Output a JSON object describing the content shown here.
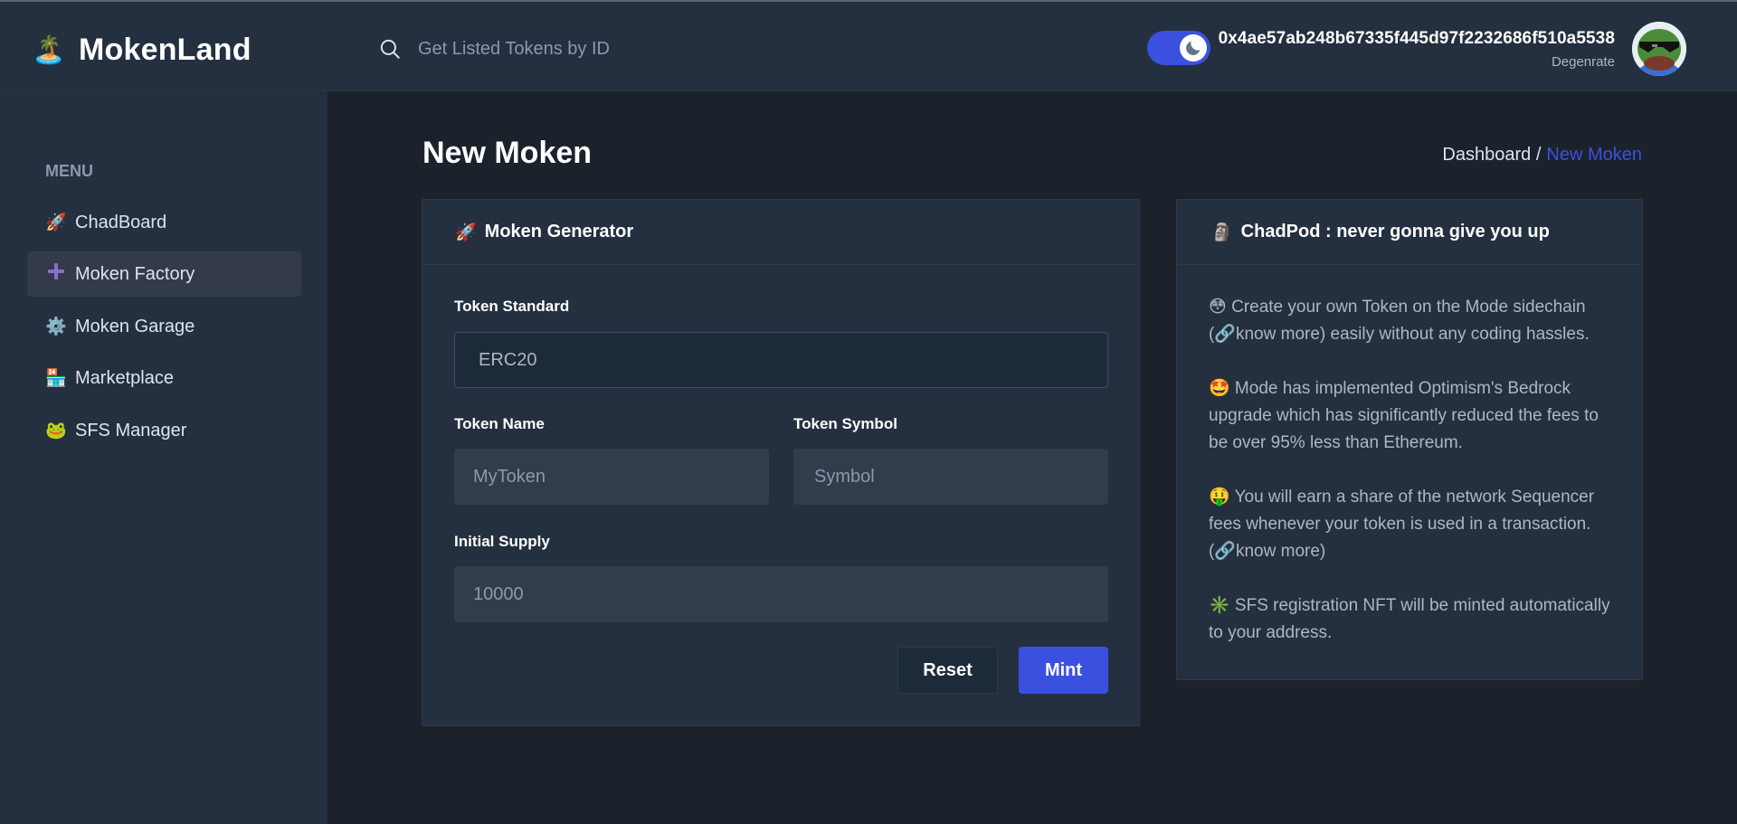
{
  "header": {
    "app_name": "MokenLand",
    "logo_emoji": "🏝️",
    "search_placeholder": "Get Listed Tokens by ID",
    "theme": "dark",
    "account_address": "0x4ae57ab248b67335f445d97f2232686f510a5538",
    "account_role": "Degenrate"
  },
  "sidebar": {
    "menu_title": "MENU",
    "items": [
      {
        "icon": "🚀",
        "icon_name": "rocket-icon",
        "label": "ChadBoard",
        "active": false
      },
      {
        "icon": "➕",
        "icon_name": "plus-icon",
        "label": "Moken Factory",
        "active": true
      },
      {
        "icon": "⚙️",
        "icon_name": "gear-icon",
        "label": "Moken Garage",
        "active": false
      },
      {
        "icon": "🏪",
        "icon_name": "store-icon",
        "label": "Marketplace",
        "active": false
      },
      {
        "icon": "🐸",
        "icon_name": "frog-icon",
        "label": "SFS Manager",
        "active": false
      }
    ]
  },
  "page": {
    "title": "New Moken",
    "breadcrumb_parent": "Dashboard /",
    "breadcrumb_current": "New Moken"
  },
  "generator": {
    "emoji": "🚀",
    "title": "Moken Generator",
    "standard_label": "Token Standard",
    "standard_value": "ERC20",
    "name_label": "Token Name",
    "name_placeholder": "MyToken",
    "symbol_label": "Token Symbol",
    "symbol_placeholder": "Symbol",
    "supply_label": "Initial Supply",
    "supply_placeholder": "10000",
    "reset_label": "Reset",
    "mint_label": "Mint"
  },
  "info": {
    "emoji": "🗿",
    "title": "ChadPod : never gonna give you up",
    "paragraphs": [
      "😳 Create your own Token on the Mode sidechain (🔗know more) easily without any coding hassles.",
      "🤩 Mode has implemented Optimism's Bedrock upgrade which has significantly reduced the fees to be over 95% less than Ethereum.",
      "🤑 You will earn a share of the network Sequencer fees whenever your token is used in a transaction. (🔗know more)",
      "✳️ SFS registration NFT will be minted automatically to your address."
    ]
  },
  "colors": {
    "accent": "#3c50e0",
    "background": "#1b222c",
    "panel": "#24303f"
  }
}
